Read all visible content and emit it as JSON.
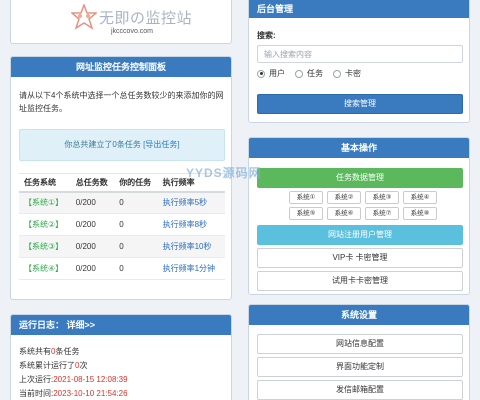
{
  "logo": {
    "name": "无即の监控站",
    "domain": "jkcccovo.com"
  },
  "task_panel": {
    "title": "网址监控任务控制面板",
    "intro": "请从以下4个系统中选择一个总任务数较少的来添加你的网址监控任务。",
    "notice_text": "你总共建立了0条任务",
    "export_link": "[导出任务]",
    "headers": [
      "任务系统",
      "总任务数",
      "你的任务",
      "执行频率"
    ],
    "rows": [
      {
        "system": "【系统①】",
        "total": "0/200",
        "mine": "0",
        "freq": "执行频率5秒"
      },
      {
        "system": "【系统②】",
        "total": "0/200",
        "mine": "0",
        "freq": "执行频率8秒"
      },
      {
        "system": "【系统③】",
        "total": "0/200",
        "mine": "0",
        "freq": "执行频率10秒"
      },
      {
        "system": "【系统④】",
        "total": "0/200",
        "mine": "0",
        "freq": "执行频率1分钟"
      }
    ]
  },
  "log_panel": {
    "title": "运行日志：",
    "detail_link": "详细>>",
    "line1": {
      "prefix": "系统共有",
      "value": "0",
      "suffix": "条任务"
    },
    "line2": {
      "prefix": "系统累计运行了",
      "value": "0",
      "suffix": "次"
    },
    "line3": {
      "prefix": "上次运行:",
      "value": "2021-08-15 12:08:39"
    },
    "line4": {
      "prefix": "当前时间:",
      "value": "2023-10-10 21:54:26"
    }
  },
  "admin_panel": {
    "title": "后台管理",
    "search_label": "搜索:",
    "search_placeholder": "输入搜索内容",
    "radio_options": [
      "用户",
      "任务",
      "卡密"
    ],
    "selected_radio": "用户",
    "search_button": "搜索管理"
  },
  "ops_panel": {
    "title": "基本操作",
    "task_data_button": "任务数据管理",
    "system_buttons": [
      "系统①",
      "系统②",
      "系统③",
      "系统④",
      "系统⑤",
      "系统⑥",
      "系统⑦",
      "系统⑧"
    ],
    "register_button": "网站注册用户管理",
    "vip_button": "VIP卡 卡密管理",
    "trial_button": "试用卡卡密管理"
  },
  "settings_panel": {
    "title": "系统设置",
    "site_info_button": "网站信息配置",
    "ui_button": "界面功能定制",
    "mail_button": "发信邮箱配置"
  },
  "watermark": "YYDS源码网",
  "colors": {
    "header_blue": "#3a7bc0",
    "green": "#5cb85c",
    "cyan": "#5bc0de",
    "system_green": "#2aa84a",
    "link_blue": "#2a6cc0",
    "red": "#d9322b"
  }
}
